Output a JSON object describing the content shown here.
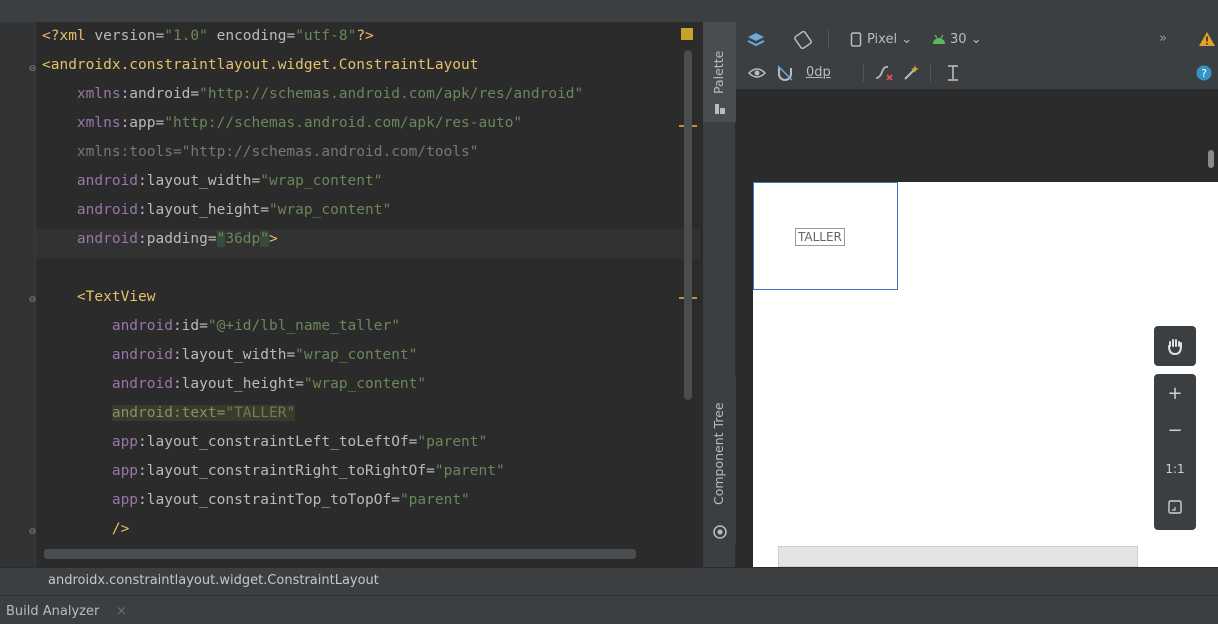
{
  "editor": {
    "lines": [
      [
        {
          "c": "tag",
          "t": "<?xml "
        },
        {
          "c": "attr",
          "t": "version="
        },
        {
          "c": "val",
          "t": "\"1.0\""
        },
        {
          "c": "attr",
          "t": " encoding="
        },
        {
          "c": "val",
          "t": "\"utf-8\""
        },
        {
          "c": "tag",
          "t": "?>"
        }
      ],
      [
        {
          "c": "tag",
          "t": "<androidx.constraintlayout.widget.ConstraintLayout"
        }
      ],
      [
        {
          "c": "",
          "t": "    "
        },
        {
          "c": "ns",
          "t": "xmlns"
        },
        {
          "c": "attr",
          "t": ":android="
        },
        {
          "c": "val",
          "t": "\"http://schemas.android.com/apk/res/android\""
        }
      ],
      [
        {
          "c": "",
          "t": "    "
        },
        {
          "c": "ns",
          "t": "xmlns"
        },
        {
          "c": "attr",
          "t": ":app="
        },
        {
          "c": "val",
          "t": "\"http://schemas.android.com/apk/res-auto\""
        }
      ],
      [
        {
          "c": "",
          "t": "    "
        },
        {
          "c": "dim",
          "t": "xmlns:tools=\"http://schemas.android.com/tools\""
        }
      ],
      [
        {
          "c": "",
          "t": "    "
        },
        {
          "c": "ns",
          "t": "android"
        },
        {
          "c": "attr",
          "t": ":layout_width="
        },
        {
          "c": "val",
          "t": "\"wrap_content\""
        }
      ],
      [
        {
          "c": "",
          "t": "    "
        },
        {
          "c": "ns",
          "t": "android"
        },
        {
          "c": "attr",
          "t": ":layout_height="
        },
        {
          "c": "val",
          "t": "\"wrap_content\""
        }
      ],
      [
        {
          "c": "",
          "t": "    "
        },
        {
          "c": "ns",
          "t": "android"
        },
        {
          "c": "attr",
          "t": ":padding="
        },
        {
          "c": "val caret",
          "t": "\""
        },
        {
          "c": "val",
          "t": "36dp"
        },
        {
          "c": "val caret",
          "t": "\""
        },
        {
          "c": "tag",
          "t": ">"
        }
      ],
      [
        {
          "c": "",
          "t": ""
        }
      ],
      [
        {
          "c": "",
          "t": "    "
        },
        {
          "c": "tag",
          "t": "<TextView"
        }
      ],
      [
        {
          "c": "",
          "t": "        "
        },
        {
          "c": "ns",
          "t": "android"
        },
        {
          "c": "attr",
          "t": ":id="
        },
        {
          "c": "val",
          "t": "\"@+id/lbl_name_taller\""
        }
      ],
      [
        {
          "c": "",
          "t": "        "
        },
        {
          "c": "ns",
          "t": "android"
        },
        {
          "c": "attr",
          "t": ":layout_width="
        },
        {
          "c": "val",
          "t": "\"wrap_content\""
        }
      ],
      [
        {
          "c": "",
          "t": "        "
        },
        {
          "c": "ns",
          "t": "android"
        },
        {
          "c": "attr",
          "t": ":layout_height="
        },
        {
          "c": "val",
          "t": "\"wrap_content\""
        }
      ],
      [
        {
          "c": "",
          "t": "        "
        },
        {
          "c": "hl",
          "t": "android:text="
        },
        {
          "c": "hlv",
          "t": "\"TALLER\""
        }
      ],
      [
        {
          "c": "",
          "t": "        "
        },
        {
          "c": "ns",
          "t": "app"
        },
        {
          "c": "attr",
          "t": ":layout_constraintLeft_toLeftOf="
        },
        {
          "c": "val",
          "t": "\"parent\""
        }
      ],
      [
        {
          "c": "",
          "t": "        "
        },
        {
          "c": "ns",
          "t": "app"
        },
        {
          "c": "attr",
          "t": ":layout_constraintRight_toRightOf="
        },
        {
          "c": "val",
          "t": "\"parent\""
        }
      ],
      [
        {
          "c": "",
          "t": "        "
        },
        {
          "c": "ns",
          "t": "app"
        },
        {
          "c": "attr",
          "t": ":layout_constraintTop_toTopOf="
        },
        {
          "c": "val",
          "t": "\"parent\""
        }
      ],
      [
        {
          "c": "",
          "t": "        "
        },
        {
          "c": "tag",
          "t": "/>"
        }
      ]
    ]
  },
  "side_tabs": {
    "palette": "Palette",
    "component_tree": "Component Tree"
  },
  "toolbar1": {
    "device": "Pixel",
    "api": "30",
    "overflow": "»"
  },
  "toolbar2": {
    "margin": "0dp"
  },
  "canvas": {
    "textview_label": "TALLER"
  },
  "zoom": {
    "plus": "+",
    "minus": "−",
    "one_to_one": "1:1"
  },
  "breadcrumb": "androidx.constraintlayout.widget.ConstraintLayout",
  "bottom_tab": {
    "label": "Build Analyzer",
    "close": "×"
  },
  "colors": {
    "accent_blue": "#3b75c6",
    "warning_yellow": "#c7a22b",
    "android_green": "#5fb85c",
    "help_blue": "#3592c4"
  }
}
